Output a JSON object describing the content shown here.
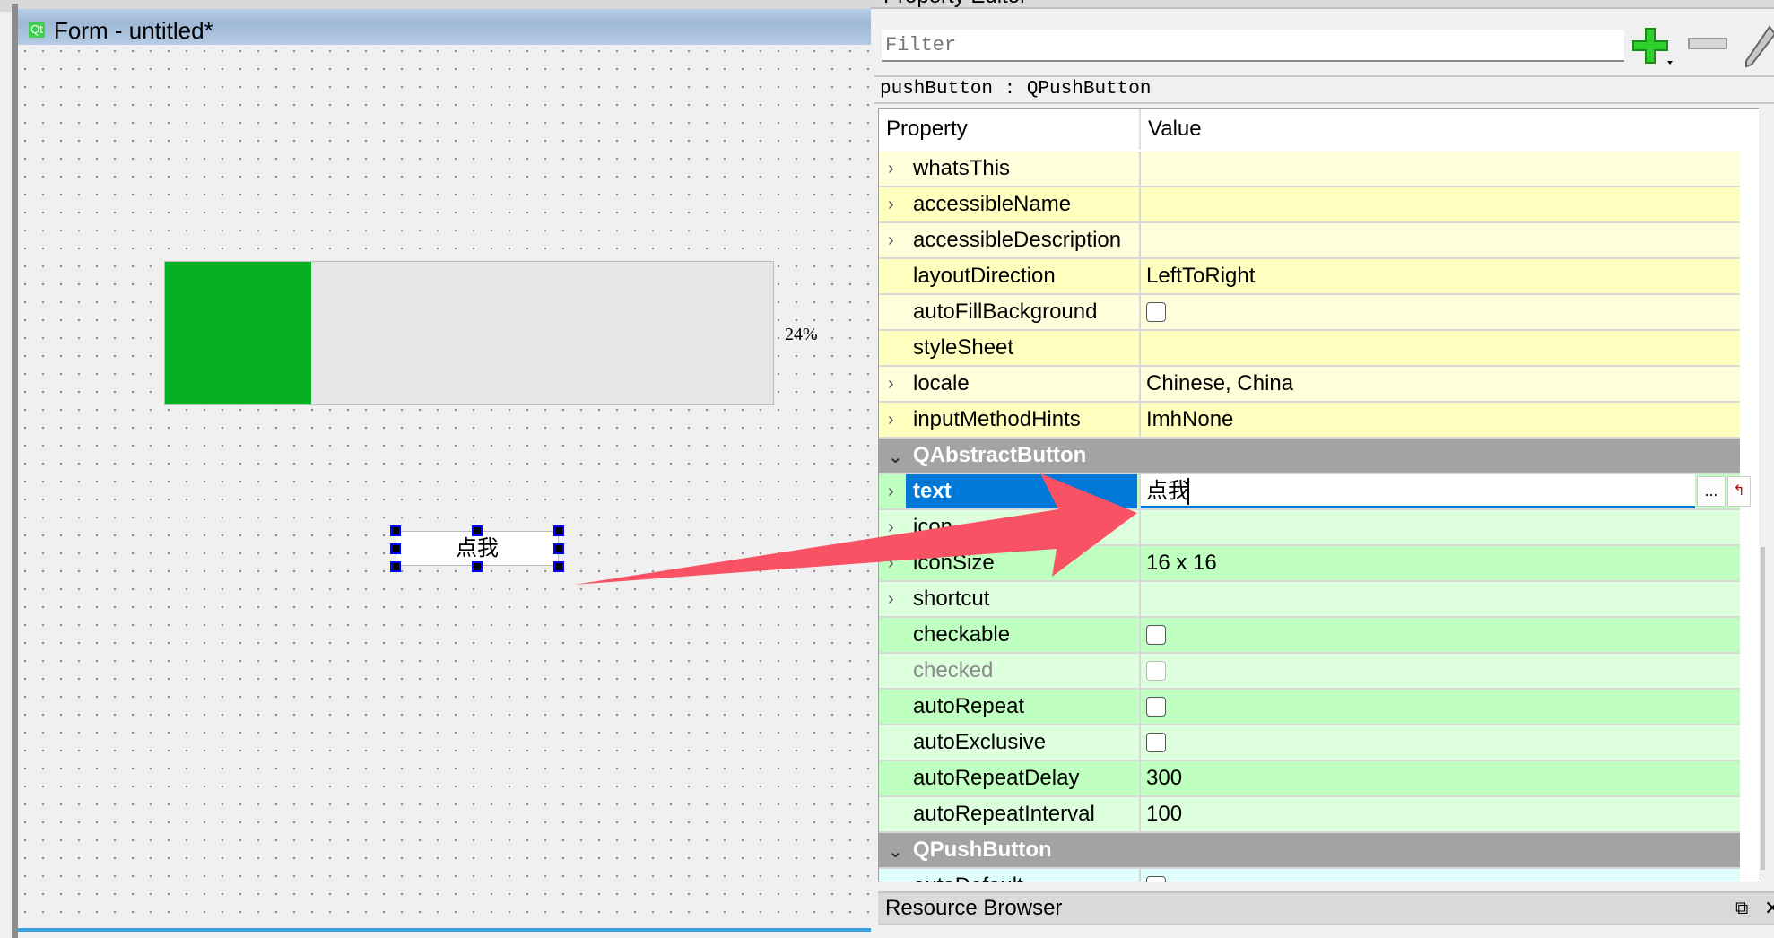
{
  "form_window": {
    "title": "Form - untitled*",
    "logo_text": "Qt",
    "progress": {
      "value_percent": 24,
      "label": "24%",
      "fill_color": "#06b025"
    },
    "push_button": {
      "text": "点我",
      "selected": true
    }
  },
  "property_editor": {
    "title": "Property Editor",
    "filter_placeholder": "Filter",
    "tools": [
      "add-dynamic-property-icon",
      "remove-property-icon",
      "configure-wrench-icon"
    ],
    "object_label": "pushButton : QPushButton",
    "headers": {
      "property": "Property",
      "value": "Value"
    },
    "rows": [
      {
        "name": "whatsThis",
        "value": "",
        "expandable": true,
        "group": "QWidget"
      },
      {
        "name": "accessibleName",
        "value": "",
        "expandable": true,
        "group": "QWidget"
      },
      {
        "name": "accessibleDescription",
        "value": "",
        "expandable": true,
        "group": "QWidget"
      },
      {
        "name": "layoutDirection",
        "value": "LeftToRight",
        "group": "QWidget"
      },
      {
        "name": "autoFillBackground",
        "checkbox": false,
        "group": "QWidget"
      },
      {
        "name": "styleSheet",
        "value": "",
        "group": "QWidget"
      },
      {
        "name": "locale",
        "value": "Chinese, China",
        "expandable": true,
        "group": "QWidget"
      },
      {
        "name": "inputMethodHints",
        "value": "ImhNone",
        "expandable": true,
        "group": "QWidget"
      },
      {
        "header": "QAbstractButton"
      },
      {
        "name": "text",
        "value": "点我",
        "expandable": true,
        "editing": true,
        "group": "QAbstractButton"
      },
      {
        "name": "icon",
        "value": "",
        "expandable": true,
        "group": "QAbstractButton"
      },
      {
        "name": "iconSize",
        "value": "16 x 16",
        "expandable": true,
        "group": "QAbstractButton"
      },
      {
        "name": "shortcut",
        "value": "",
        "expandable": true,
        "group": "QAbstractButton"
      },
      {
        "name": "checkable",
        "checkbox": false,
        "group": "QAbstractButton"
      },
      {
        "name": "checked",
        "checkbox": false,
        "disabled": true,
        "group": "QAbstractButton"
      },
      {
        "name": "autoRepeat",
        "checkbox": false,
        "group": "QAbstractButton"
      },
      {
        "name": "autoExclusive",
        "checkbox": false,
        "group": "QAbstractButton"
      },
      {
        "name": "autoRepeatDelay",
        "value": "300",
        "group": "QAbstractButton"
      },
      {
        "name": "autoRepeatInterval",
        "value": "100",
        "group": "QAbstractButton"
      },
      {
        "header": "QPushButton"
      },
      {
        "name": "autoDefault",
        "checkbox": false,
        "group": "QPushButton"
      }
    ],
    "edit_more_label": "...",
    "colors": {
      "QWidget": [
        "#ffffdc",
        "#ffffbf"
      ],
      "QAbstractButton": [
        "#ddffdd",
        "#bfffbf"
      ],
      "QPushButton": [
        "#dfffff",
        "#bfffff"
      ],
      "selection": "#0078d7",
      "annotation_arrow": "#f85264"
    }
  },
  "resource_browser": {
    "title": "Resource Browser"
  }
}
